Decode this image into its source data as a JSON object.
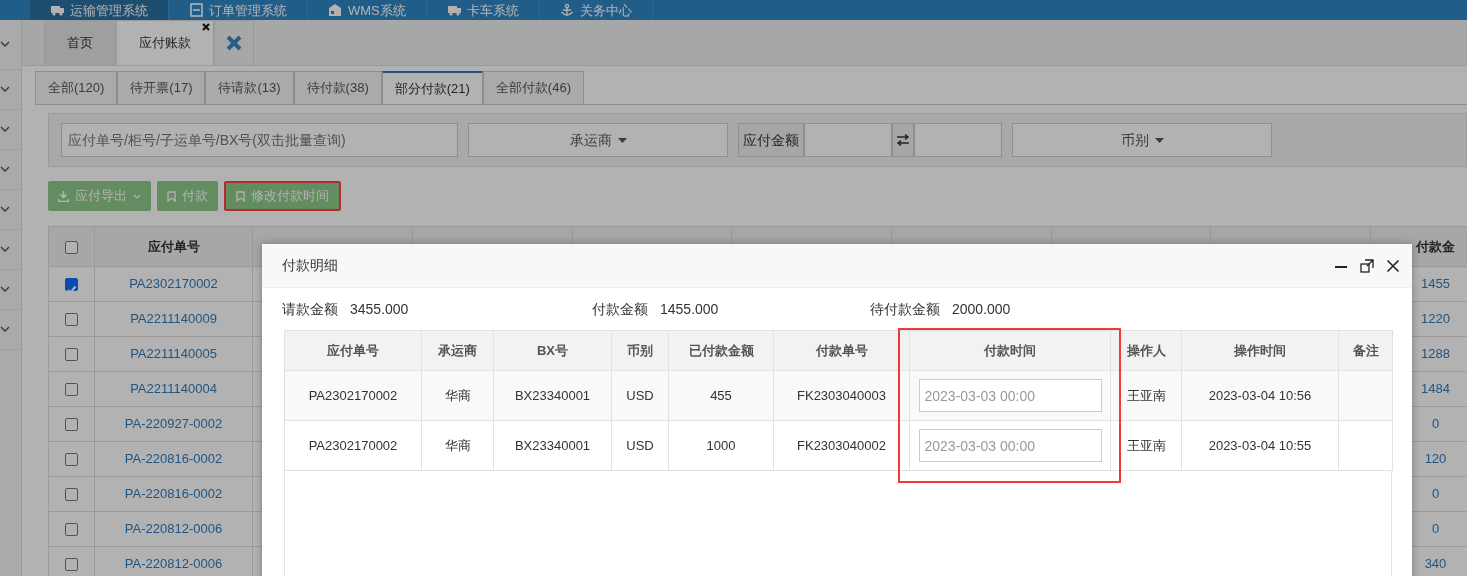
{
  "top_nav": [
    {
      "label": "运输管理系统",
      "selected": true
    },
    {
      "label": "订单管理系统",
      "selected": false
    },
    {
      "label": "WMS系统",
      "selected": false
    },
    {
      "label": "卡车系统",
      "selected": false
    },
    {
      "label": "关务中心",
      "selected": false
    }
  ],
  "page_tabs": [
    {
      "label": "首页",
      "selected": false,
      "closable": false
    },
    {
      "label": "应付账款",
      "selected": true,
      "closable": true
    }
  ],
  "status_tabs": [
    {
      "label": "全部(120)",
      "selected": false
    },
    {
      "label": "待开票(17)",
      "selected": false
    },
    {
      "label": "待请款(13)",
      "selected": false
    },
    {
      "label": "待付款(38)",
      "selected": false
    },
    {
      "label": "部分付款(21)",
      "selected": true
    },
    {
      "label": "全部付款(46)",
      "selected": false
    }
  ],
  "filters": {
    "search": {
      "placeholder": "应付单号/柜号/子运单号/BX号(双击批量查询)"
    },
    "carrier": "承运商",
    "amount_label": "应付金额",
    "currency": "币别"
  },
  "toolbar": [
    {
      "label": "应付导出",
      "kind": "export",
      "highlighted": false
    },
    {
      "label": "付款",
      "kind": "bookmark",
      "highlighted": false
    },
    {
      "label": "修改付款时间",
      "kind": "bookmark",
      "highlighted": true
    }
  ],
  "table": {
    "select_all_checked": false,
    "columns": [
      "应付单号",
      "付款金"
    ],
    "rows": [
      {
        "checked": true,
        "number": "PA2302170002",
        "paid": "1455"
      },
      {
        "checked": false,
        "number": "PA2211140009",
        "paid": "1220"
      },
      {
        "checked": false,
        "number": "PA2211140005",
        "paid": "1288"
      },
      {
        "checked": false,
        "number": "PA2211140004",
        "paid": "1484"
      },
      {
        "checked": false,
        "number": "PA-220927-0002",
        "paid": "0"
      },
      {
        "checked": false,
        "number": "PA-220816-0002",
        "paid": "120"
      },
      {
        "checked": false,
        "number": "PA-220816-0002",
        "paid": "0"
      },
      {
        "checked": false,
        "number": "PA-220812-0006",
        "paid": "0"
      },
      {
        "checked": false,
        "number": "PA-220812-0006",
        "paid": "340"
      }
    ]
  },
  "modal": {
    "title": "付款明细",
    "summary": [
      {
        "label": "请款金额",
        "value": "3455.000"
      },
      {
        "label": "付款金额",
        "value": "1455.000"
      },
      {
        "label": "待付款金额",
        "value": "2000.000"
      }
    ],
    "columns": [
      {
        "label": "应付单号",
        "highlighted": false
      },
      {
        "label": "承运商",
        "highlighted": false
      },
      {
        "label": "BX号",
        "highlighted": false
      },
      {
        "label": "币别",
        "highlighted": false
      },
      {
        "label": "已付款金额",
        "highlighted": false
      },
      {
        "label": "付款单号",
        "highlighted": false
      },
      {
        "label": "付款时间",
        "highlighted": true
      },
      {
        "label": "操作人",
        "highlighted": false
      },
      {
        "label": "操作时间",
        "highlighted": false
      },
      {
        "label": "备注",
        "highlighted": false
      }
    ],
    "rows": [
      {
        "cells": [
          "PA2302170002",
          "华商",
          "BX23340001",
          "USD",
          "455",
          "FK2303040003"
        ],
        "payment_time": {
          "placeholder": "2023-03-03 00:00"
        },
        "operator": "王亚南",
        "op_time": "2023-03-04 10:56"
      },
      {
        "cells": [
          "PA2302170002",
          "华商",
          "BX23340001",
          "USD",
          "1000",
          "FK2303040002"
        ],
        "payment_time": {
          "placeholder": "2023-03-03 00:00"
        },
        "operator": "王亚南",
        "op_time": "2023-03-04 10:55"
      }
    ]
  }
}
